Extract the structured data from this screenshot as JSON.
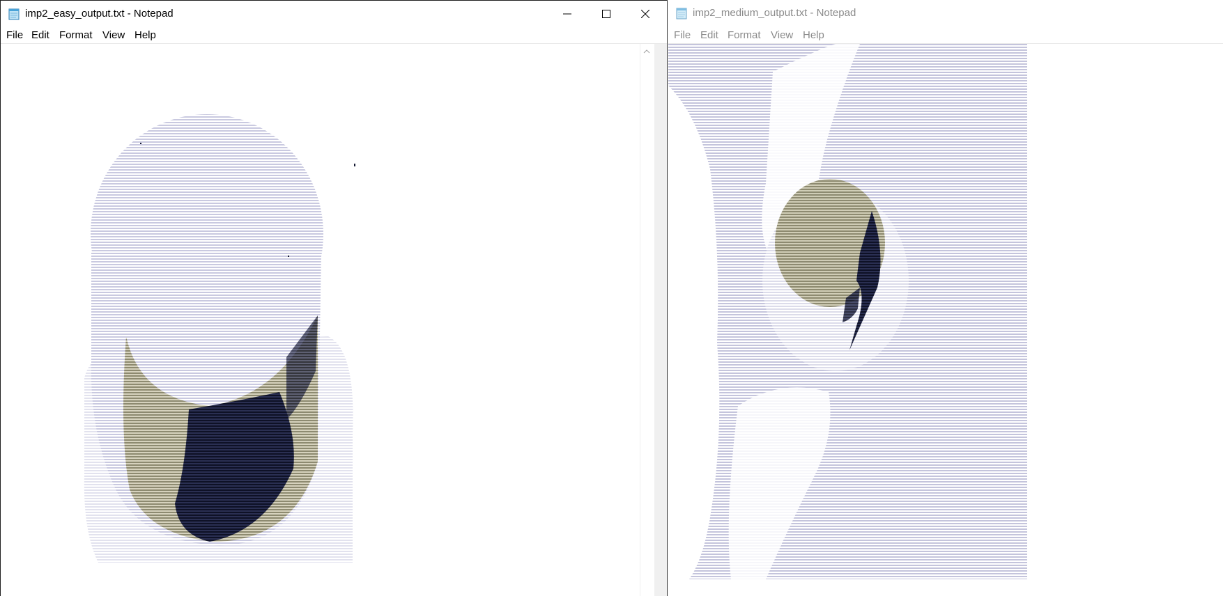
{
  "left_window": {
    "title": "imp2_easy_output.txt - Notepad",
    "menu": [
      "File",
      "Edit",
      "Format",
      "View",
      "Help"
    ],
    "icons": {
      "app": "notepad-icon",
      "minimize": "minimize-icon",
      "maximize": "maximize-icon",
      "close": "close-icon",
      "scroll_up": "chevron-up-icon"
    },
    "content_description_colors": {
      "lavender": "#c9c9e0",
      "olive": "#b7b39a",
      "navy": "#161a33"
    }
  },
  "right_window": {
    "title": "imp2_medium_output.txt - Notepad",
    "menu": [
      "File",
      "Edit",
      "Format",
      "View",
      "Help"
    ],
    "state": "inactive",
    "icons": {
      "app": "notepad-icon"
    }
  },
  "colors": {
    "title_active": "#000000",
    "title_inactive": "#8a8a8a",
    "ascii_light": "#c9c9e0",
    "ascii_olive": "#b7b39a",
    "ascii_dark": "#161a33"
  }
}
